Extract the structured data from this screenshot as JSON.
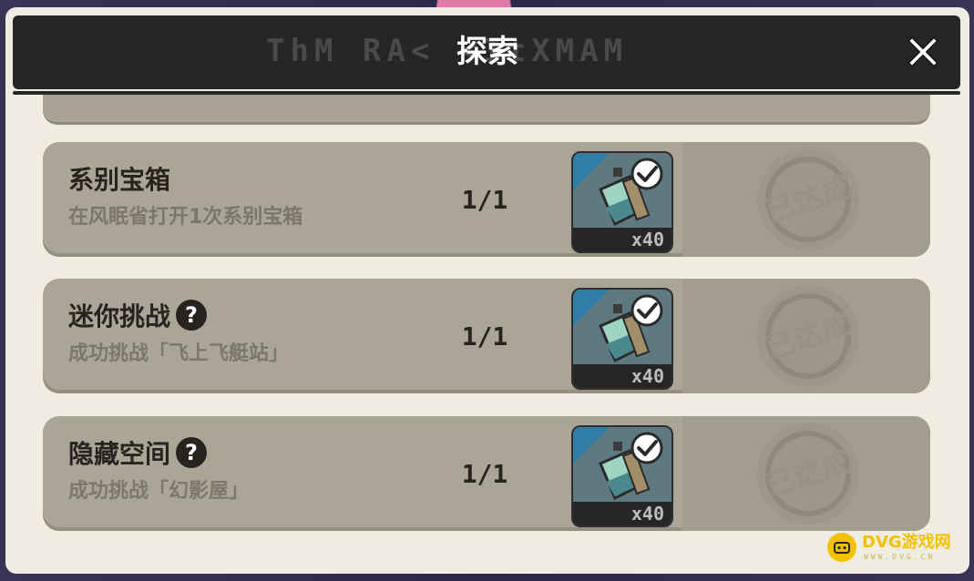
{
  "header": {
    "title": "探索",
    "decorative_text": "ThM RA<  <ItXMAM",
    "close_icon": "close-icon"
  },
  "tasks": [
    {
      "title": "系别宝箱",
      "description": "在风眠省打开1次系别宝箱",
      "has_help": false,
      "progress": "1/1",
      "reward": {
        "quantity": "x40",
        "icon": "bottle-icon",
        "claimed": true
      },
      "stamp": "已达成"
    },
    {
      "title": "迷你挑战",
      "description": "成功挑战「飞上飞艇站」",
      "has_help": true,
      "help_label": "?",
      "progress": "1/1",
      "reward": {
        "quantity": "x40",
        "icon": "bottle-icon",
        "claimed": true
      },
      "stamp": "已达成"
    },
    {
      "title": "隐藏空间",
      "description": "成功挑战「幻影屋」",
      "has_help": true,
      "help_label": "?",
      "progress": "1/1",
      "reward": {
        "quantity": "x40",
        "icon": "bottle-icon",
        "claimed": true
      },
      "stamp": "已达成"
    }
  ],
  "watermark": {
    "text": "DVG游戏网",
    "subtext": "WWW.DVG.CN"
  },
  "colors": {
    "panel": "#efece2",
    "title_bar": "#262626",
    "card": "#aaa596",
    "text_dark": "#272420",
    "text_muted": "#7b776c",
    "watermark": "#f2c200"
  }
}
